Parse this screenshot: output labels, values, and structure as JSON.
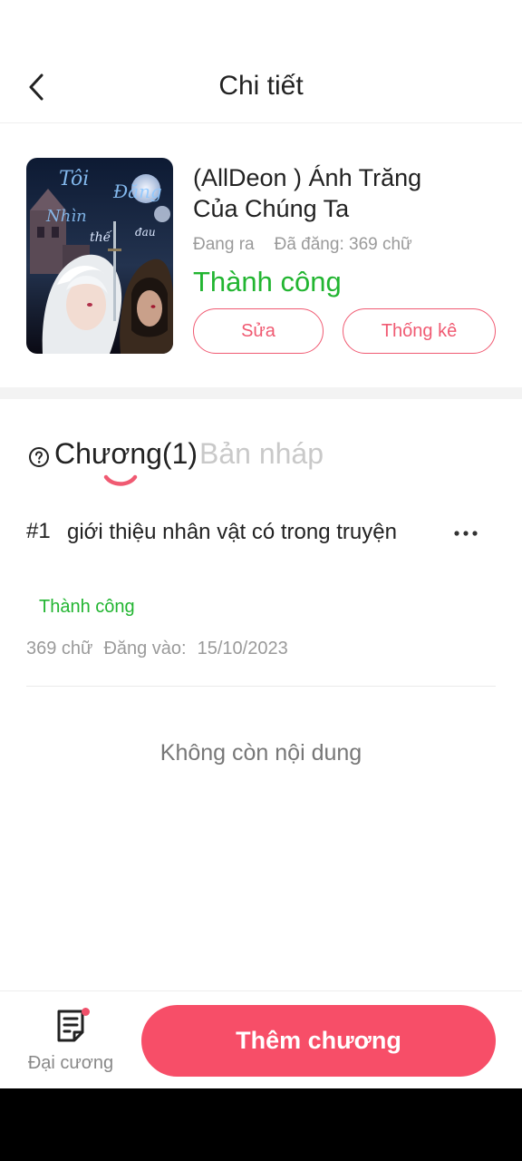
{
  "header": {
    "title": "Chi tiết",
    "back_icon": "chevron-left-icon"
  },
  "book": {
    "title": "(AllDeon ) Ánh Trăng Của Chúng Ta",
    "state": "Đang ra",
    "word_count_label": "Đã đăng: 369 chữ",
    "status": "Thành công",
    "edit_label": "Sửa",
    "stats_label": "Thống kê",
    "cover_text": "Tôi Đã Từng Nhìn Thấy Ánh Trăng Trên Thế Giới Đau"
  },
  "tabs": {
    "help_icon": "question-circle-icon",
    "chapters_label": "Chương(1)",
    "drafts_label": "Bản nháp"
  },
  "chapters": [
    {
      "number": "#1",
      "title": "giới thiệu nhân vật có trong truyện",
      "status": "Thành công",
      "words": "369 chữ",
      "posted_label": "Đăng vào:",
      "posted_date": "15/10/2023"
    }
  ],
  "empty_text": "Không còn nội dung",
  "bottom": {
    "outline_label": "Đại cương",
    "add_chapter_label": "Thêm chương"
  },
  "colors": {
    "accent": "#f74e68",
    "success": "#22b531",
    "muted": "#9a9a9a"
  }
}
